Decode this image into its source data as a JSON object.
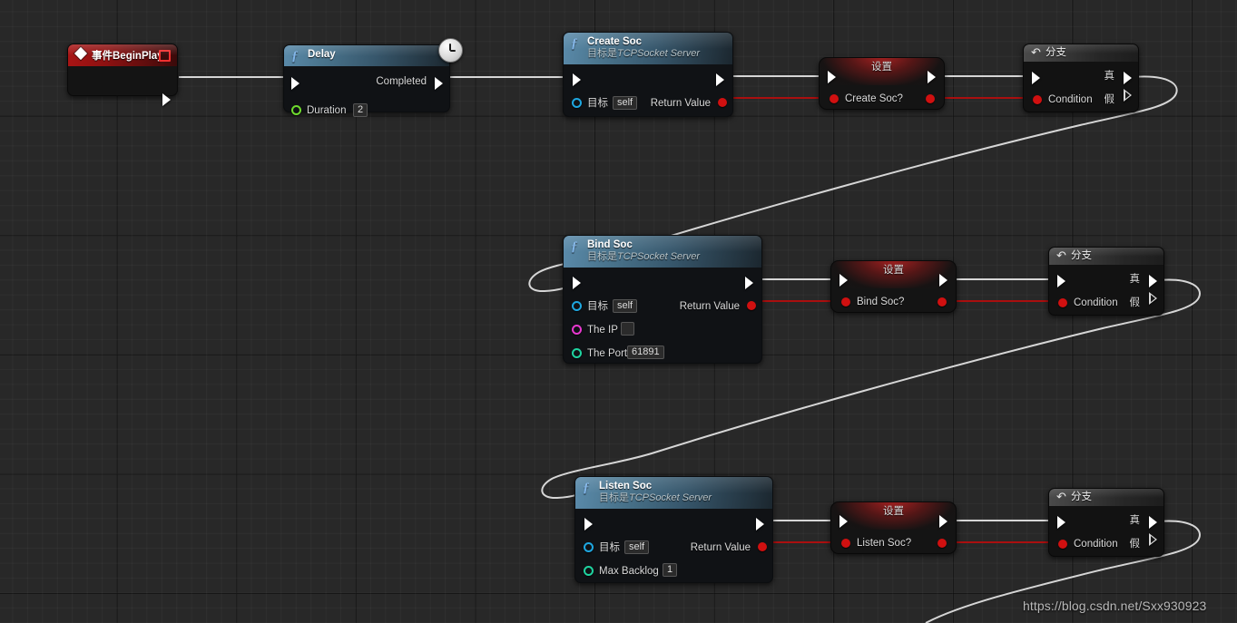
{
  "graph": {
    "background_color": "#282828",
    "watermark": "https://blog.csdn.net/Sxx930923",
    "colors": {
      "exec_wire": "#d8d8d8",
      "bool_wire": "#aa0f0f",
      "event_header": "#a81414",
      "function_header": "#4b768f",
      "object_pin": "#1ea7e0",
      "float_pin": "#6fdb2e",
      "string_pin": "#e838cf",
      "int_pin": "#1fd4a0",
      "bool_pin": "#d01010"
    }
  },
  "nodes": {
    "event_begin_play": {
      "title": "事件BeginPlay",
      "icon": "event-diamond-icon",
      "delegate_pin": "delegate-output-pin"
    },
    "delay": {
      "title": "Delay",
      "icon": "function-f-icon",
      "badge": "clock-icon",
      "exec_out_label": "Completed",
      "inputs": [
        {
          "label": "Duration",
          "value": "2",
          "pin_type": "float"
        }
      ]
    },
    "create_soc": {
      "title": "Create Soc",
      "subtitle_prefix": "目标是",
      "subtitle_target": "TCPSocket Server",
      "icon": "function-f-icon",
      "inputs": [
        {
          "label": "目标",
          "value": "self",
          "pin_type": "object"
        }
      ],
      "outputs": [
        {
          "label": "Return Value",
          "pin_type": "bool"
        }
      ]
    },
    "set_create_soc": {
      "title": "设置",
      "variable_label": "Create Soc?",
      "pin_type": "bool"
    },
    "branch_1": {
      "title": "分支",
      "icon": "branch-icon",
      "input_label": "Condition",
      "true_label": "真",
      "false_label": "假"
    },
    "bind_soc": {
      "title": "Bind Soc",
      "subtitle_prefix": "目标是",
      "subtitle_target": "TCPSocket Server",
      "icon": "function-f-icon",
      "inputs": [
        {
          "label": "目标",
          "value": "self",
          "pin_type": "object"
        },
        {
          "label": "The IP",
          "value": "",
          "pin_type": "string"
        },
        {
          "label": "The Port",
          "value": "61891",
          "pin_type": "int"
        }
      ],
      "outputs": [
        {
          "label": "Return Value",
          "pin_type": "bool"
        }
      ]
    },
    "set_bind_soc": {
      "title": "设置",
      "variable_label": "Bind Soc?",
      "pin_type": "bool"
    },
    "branch_2": {
      "title": "分支",
      "icon": "branch-icon",
      "input_label": "Condition",
      "true_label": "真",
      "false_label": "假"
    },
    "listen_soc": {
      "title": "Listen Soc",
      "subtitle_prefix": "目标是",
      "subtitle_target": "TCPSocket Server",
      "icon": "function-f-icon",
      "inputs": [
        {
          "label": "目标",
          "value": "self",
          "pin_type": "object"
        },
        {
          "label": "Max Backlog",
          "value": "1",
          "pin_type": "int"
        }
      ],
      "outputs": [
        {
          "label": "Return Value",
          "pin_type": "bool"
        }
      ]
    },
    "set_listen_soc": {
      "title": "设置",
      "variable_label": "Listen Soc?",
      "pin_type": "bool"
    },
    "branch_3": {
      "title": "分支",
      "icon": "branch-icon",
      "input_label": "Condition",
      "true_label": "真",
      "false_label": "假"
    }
  }
}
